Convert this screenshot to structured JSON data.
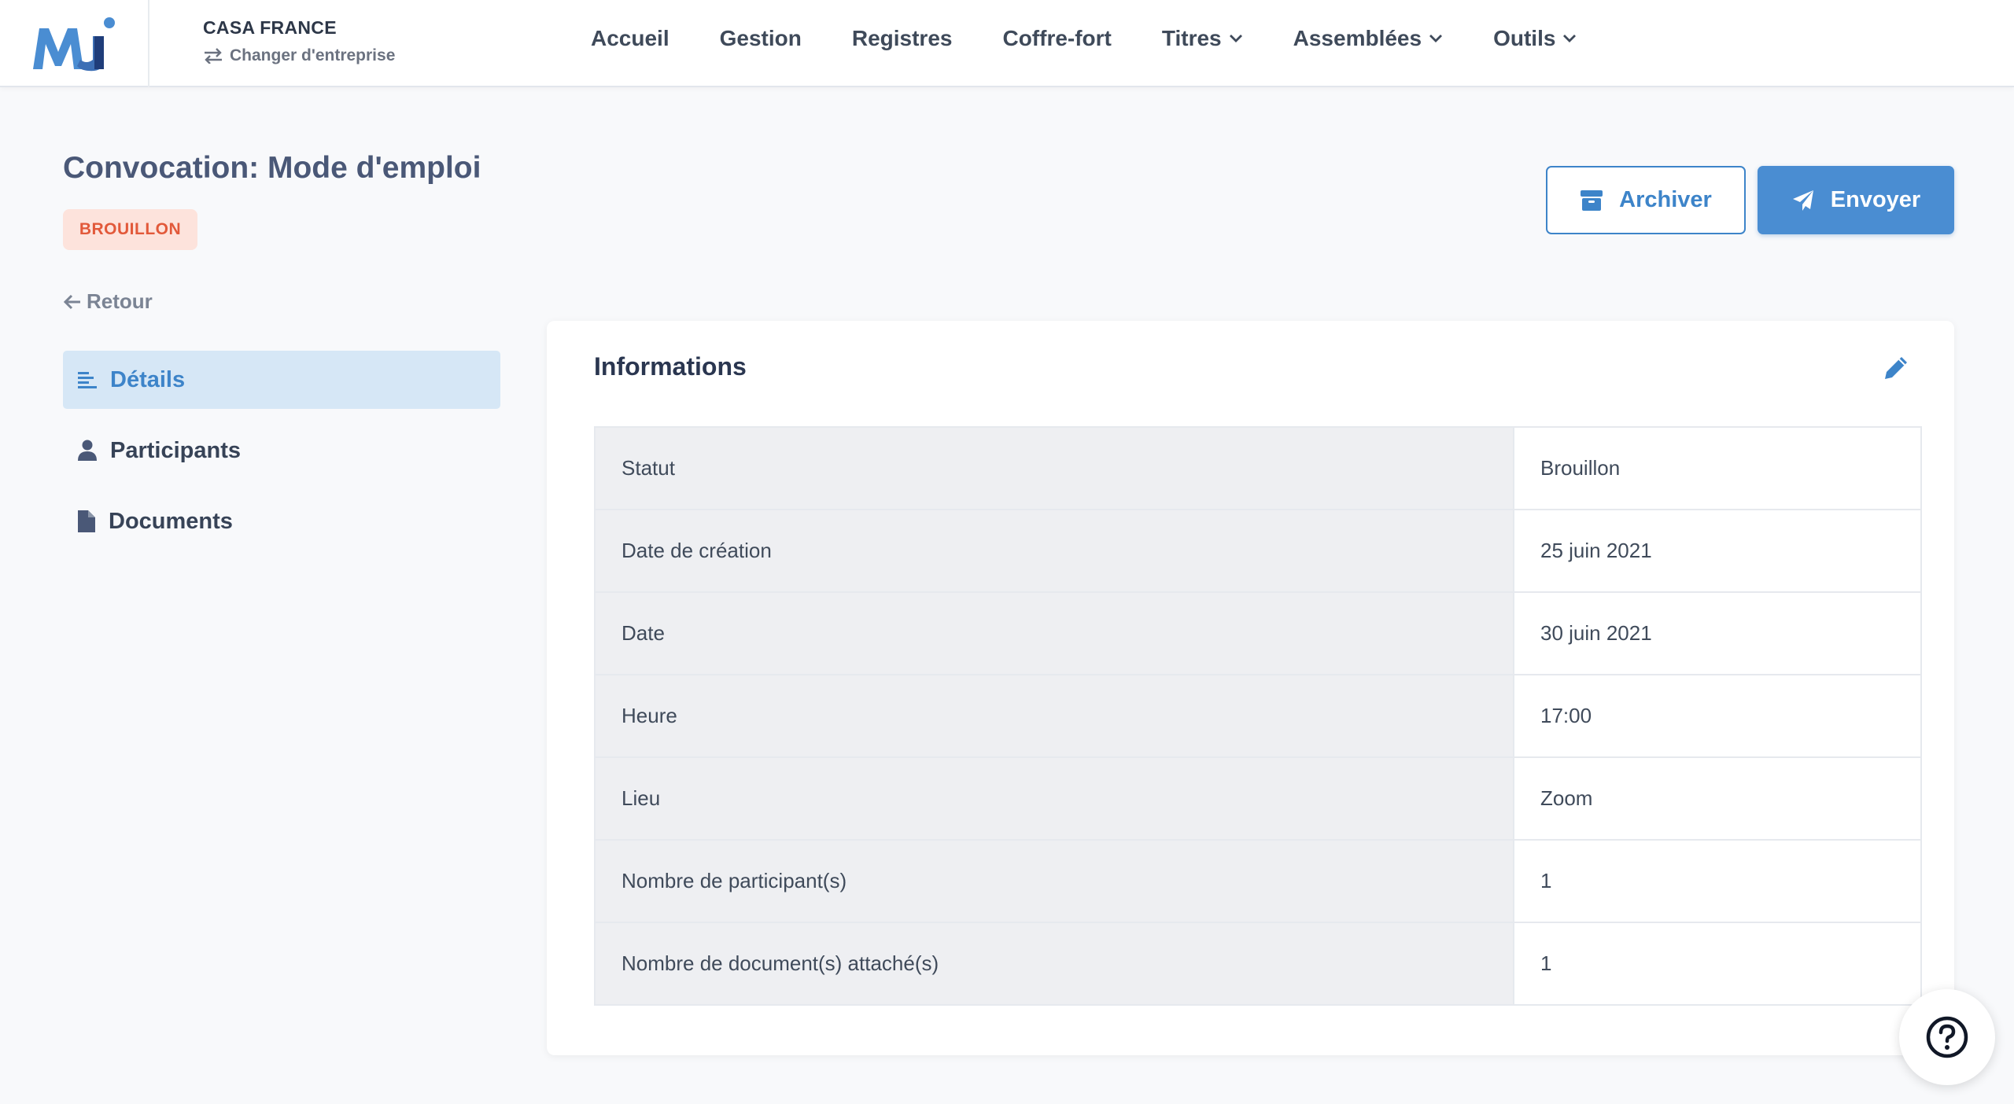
{
  "header": {
    "logo_text": "MJ",
    "company_name": "CASA FRANCE",
    "switch_company": "Changer d'entreprise",
    "nav": {
      "home": "Accueil",
      "management": "Gestion",
      "registers": "Registres",
      "safe": "Coffre-fort",
      "titles": "Titres",
      "assemblies": "Assemblées",
      "tools": "Outils"
    }
  },
  "page": {
    "title": "Convocation: Mode d'emploi",
    "status_badge": "BROUILLON",
    "archive_label": "Archiver",
    "send_label": "Envoyer",
    "back_label": "Retour"
  },
  "sidebar": {
    "items": [
      {
        "label": "Détails",
        "icon": "align-left-icon",
        "active": true
      },
      {
        "label": "Participants",
        "icon": "user-icon",
        "active": false
      },
      {
        "label": "Documents",
        "icon": "file-icon",
        "active": false
      }
    ]
  },
  "info": {
    "title": "Informations",
    "rows": [
      {
        "key": "Statut",
        "value": "Brouillon"
      },
      {
        "key": "Date de création",
        "value": "25 juin 2021"
      },
      {
        "key": "Date",
        "value": "30 juin 2021"
      },
      {
        "key": "Heure",
        "value": "17:00"
      },
      {
        "key": "Lieu",
        "value": "Zoom"
      },
      {
        "key": "Nombre de participant(s)",
        "value": "1"
      },
      {
        "key": "Nombre de document(s) attaché(s)",
        "value": "1"
      }
    ]
  },
  "colors": {
    "primary": "#4a8dd2",
    "badge_bg": "#fde3dc",
    "badge_text": "#e2593a",
    "active_bg": "#d6e7f6"
  }
}
